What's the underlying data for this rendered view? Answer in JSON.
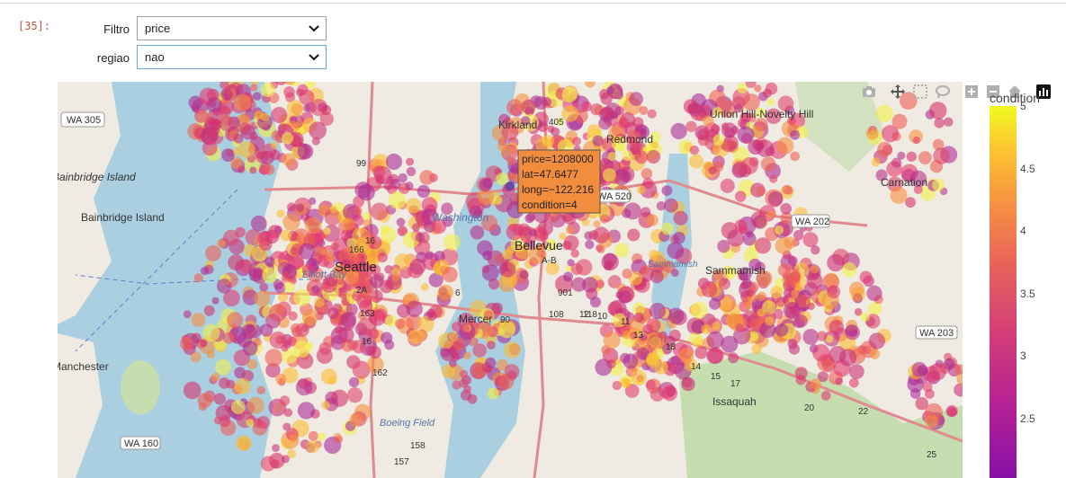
{
  "cell": {
    "prompt": "[35]:"
  },
  "widgets": {
    "filtro": {
      "label": "Filtro",
      "value": "price"
    },
    "regiao": {
      "label": "regiao",
      "value": "nao"
    }
  },
  "map": {
    "place_labels": [
      "WA 305",
      "Bainbridge Island",
      "Bainbridge Island",
      "Seattle",
      "Elliott Bay",
      "Kirkland",
      "Redmond",
      "Union Hill-Novelty Hill",
      "Carnation",
      "WA 520",
      "Washington",
      "Bellevue",
      "Sammamish",
      "Sammamish",
      "WA 202",
      "Mercer",
      "WA 203",
      "Manchester",
      "Issaquah",
      "Boeing Field",
      "WA 160",
      "99",
      "166",
      "2A",
      "163",
      "16",
      "162",
      "157",
      "158",
      "6",
      "20",
      "17",
      "15",
      "14",
      "18",
      "13",
      "11",
      "10",
      "12",
      "25",
      "22",
      "405",
      "90",
      "901",
      "A-B",
      "108",
      "118",
      "16"
    ],
    "tooltip": {
      "lines": [
        "price=1208000",
        "lat=47.6477",
        "long=−122.216",
        "condition=4"
      ],
      "color": "#f28d3d"
    },
    "colors": {
      "water": "#a9cfe0",
      "land": "#efeae2",
      "park": "#c6ddb0",
      "road": "#e08a8f"
    }
  },
  "colorbar": {
    "title": "condition",
    "ticks": [
      "5",
      "4.5",
      "4",
      "3.5",
      "3",
      "2.5"
    ],
    "values": [
      5,
      4.5,
      4,
      3.5,
      3,
      2.5
    ]
  },
  "modebar": {
    "icons": [
      "camera-icon",
      "pan-icon",
      "box-select-icon",
      "lasso-icon",
      "zoom-in-icon",
      "zoom-out-icon",
      "home-icon",
      "plotly-logo-icon"
    ]
  }
}
